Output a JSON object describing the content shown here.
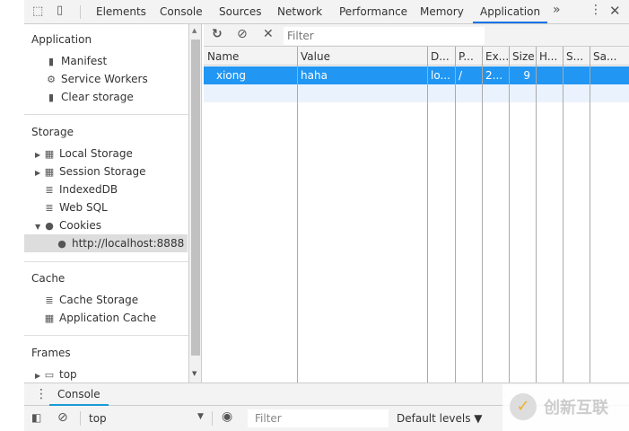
{
  "tabs": [
    "Elements",
    "Console",
    "Sources",
    "Network",
    "Performance",
    "Memory",
    "Application"
  ],
  "active_tab": "Application",
  "sidebar": {
    "application": {
      "title": "Application",
      "items": [
        "Manifest",
        "Service Workers",
        "Clear storage"
      ]
    },
    "storage": {
      "title": "Storage",
      "items": [
        "Local Storage",
        "Session Storage",
        "IndexedDB",
        "Web SQL",
        "Cookies"
      ],
      "cookie_origin": "http://localhost:8888"
    },
    "cache": {
      "title": "Cache",
      "items": [
        "Cache Storage",
        "Application Cache"
      ]
    },
    "frames": {
      "title": "Frames",
      "items": [
        "top"
      ]
    }
  },
  "toolbar": {
    "filter_placeholder": "Filter"
  },
  "table": {
    "columns": [
      "Name",
      "Value",
      "D...",
      "P...",
      "Ex...",
      "Size",
      "H...",
      "S...",
      "Sa..."
    ],
    "rows": [
      [
        "xiong",
        "haha",
        "lo...",
        "/",
        "2...",
        "9",
        "",
        "",
        ""
      ]
    ]
  },
  "drawer": {
    "tab": "Console",
    "context": "top",
    "filter_placeholder": "Filter",
    "levels": "Default levels ▼"
  },
  "watermark": "创新互联"
}
